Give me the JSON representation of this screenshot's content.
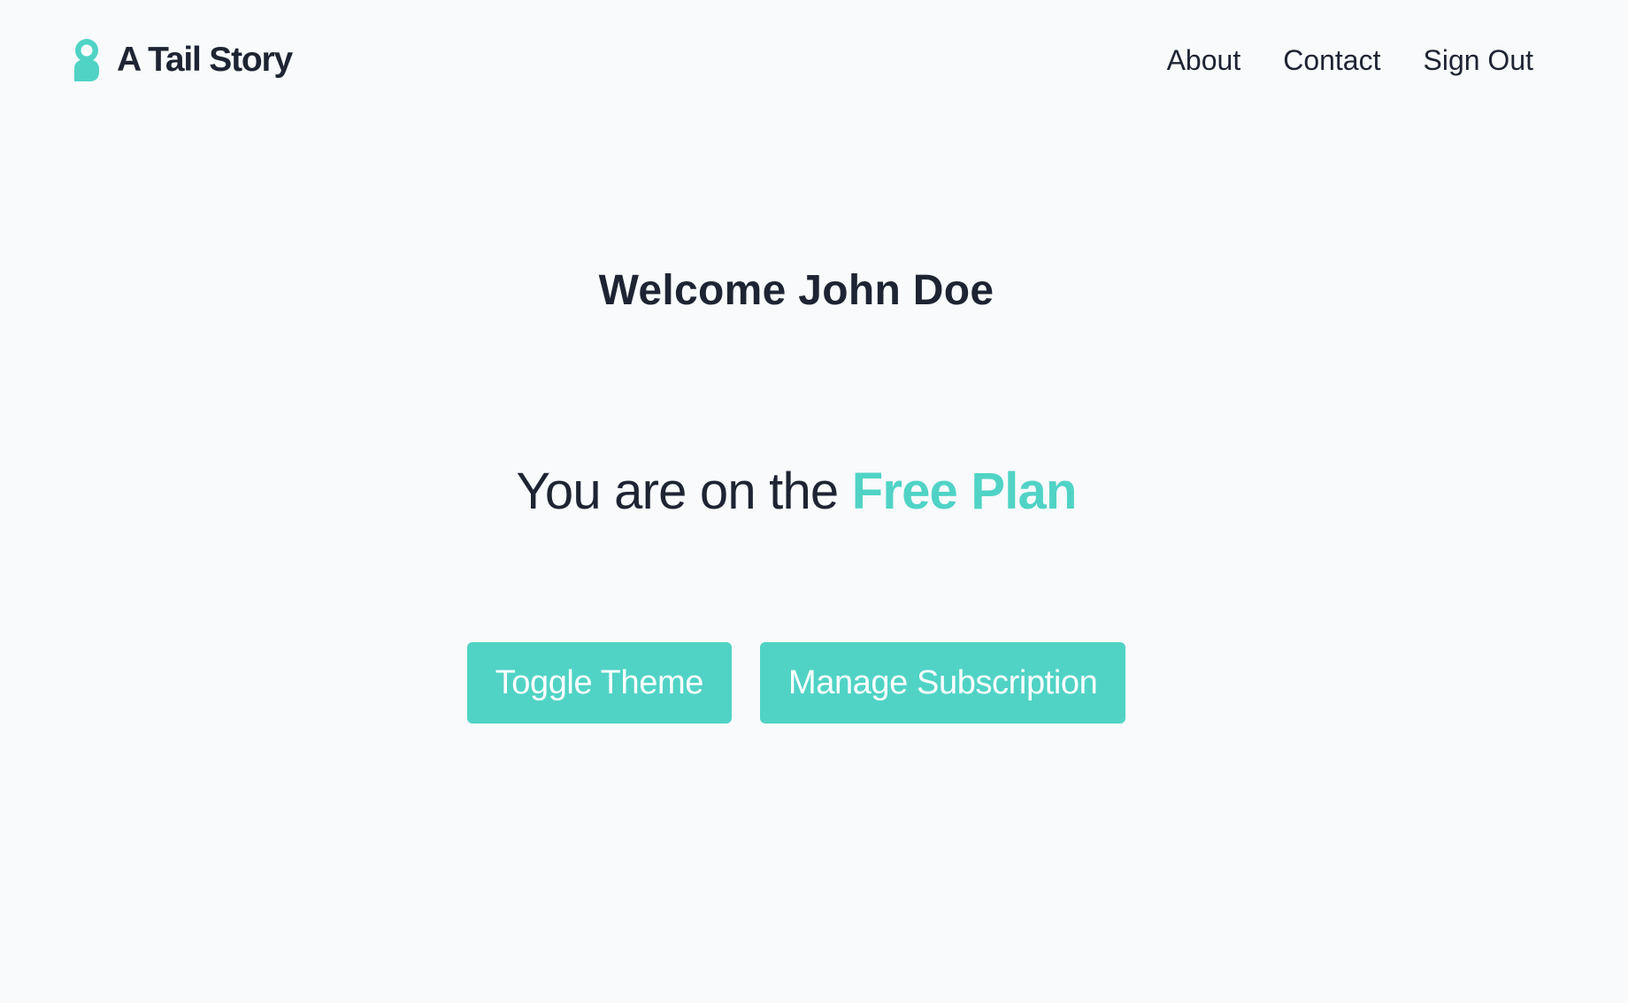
{
  "header": {
    "brand_name": "A Tail Story",
    "logo_icon": "tail-logo-icon",
    "nav": {
      "about": "About",
      "contact": "Contact",
      "sign_out": "Sign Out"
    }
  },
  "main": {
    "welcome": "Welcome John Doe",
    "plan_prefix": "You are on the",
    "plan_name": "Free Plan",
    "buttons": {
      "toggle_theme": "Toggle Theme",
      "manage_subscription": "Manage Subscription"
    }
  },
  "colors": {
    "accent": "#50d3c5",
    "text": "#1e2433",
    "background": "#f8fafc",
    "button_text": "#ffffff"
  }
}
